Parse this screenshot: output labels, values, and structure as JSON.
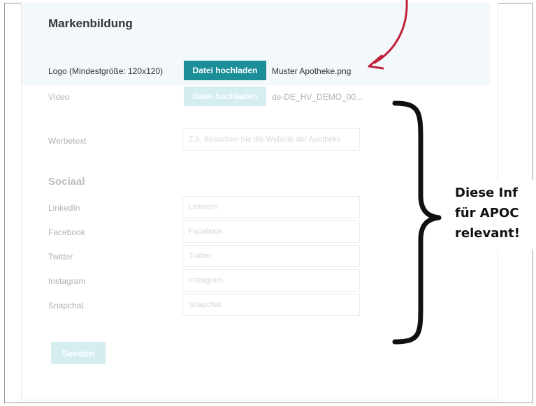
{
  "branding": {
    "title": "Markenbildung"
  },
  "logo": {
    "label": "Logo (Mindestgröße: 120x120)",
    "button": "Datei hochladen",
    "file": "Muster Apotheke.png"
  },
  "video": {
    "label": "Video",
    "button": "Datei hochladen",
    "file": "de-DE_HV_DEMO_00..."
  },
  "promo": {
    "label": "Werbetext",
    "placeholder": "Z.b. Besuchen Sie die Website der Apotheke"
  },
  "social": {
    "title": "Sociaal",
    "fields": [
      {
        "label": "LinkedIn",
        "placeholder": "LinkedIn"
      },
      {
        "label": "Facebook",
        "placeholder": "Facebook"
      },
      {
        "label": "Twitter",
        "placeholder": "Twitter"
      },
      {
        "label": "Instagram",
        "placeholder": "Instagram"
      },
      {
        "label": "Snapchat",
        "placeholder": "Snapchat"
      }
    ]
  },
  "submit": {
    "label": "Senden"
  },
  "annotation": {
    "lines": [
      "Diese Inf",
      "für APOC",
      "relevant!"
    ]
  },
  "colors": {
    "primary": "#1b8e98",
    "primary_light": "#8fd0d6",
    "arrow": "#c0213a"
  }
}
